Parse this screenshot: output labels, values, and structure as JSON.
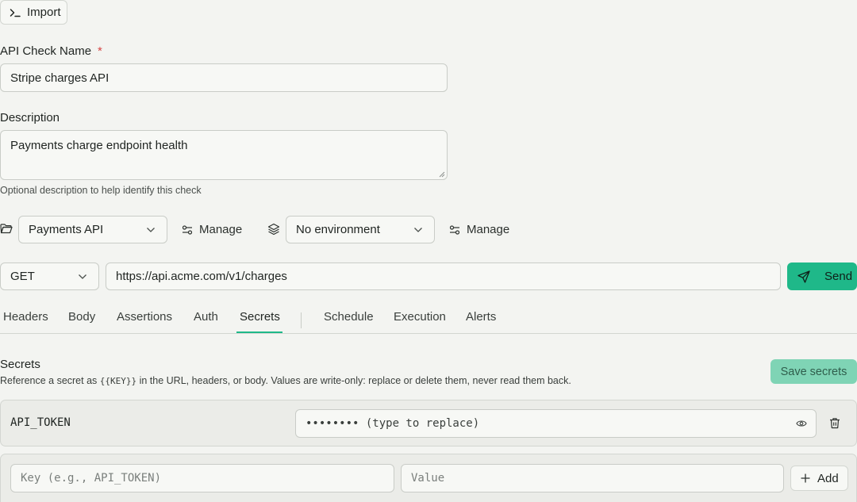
{
  "import_button": {
    "label": "Import",
    "icon": "terminal-icon"
  },
  "name_field": {
    "label": "API Check Name",
    "required_mark": "*",
    "value": "Stripe charges API"
  },
  "description_field": {
    "label": "Description",
    "value": "Payments charge endpoint health",
    "helper": "Optional description to help identify this check"
  },
  "group_row": {
    "group_select": "Payments API",
    "group_manage": "Manage",
    "environment_select": "No environment",
    "environment_manage": "Manage"
  },
  "request_row": {
    "method": "GET",
    "url": "https://api.acme.com/v1/charges",
    "send_label": "Send"
  },
  "tabs": [
    {
      "label": "Headers"
    },
    {
      "label": "Body"
    },
    {
      "label": "Assertions"
    },
    {
      "label": "Auth"
    },
    {
      "label": "Secrets"
    },
    {
      "label": "Schedule"
    },
    {
      "label": "Execution"
    },
    {
      "label": "Alerts"
    }
  ],
  "active_tab": "Secrets",
  "secrets": {
    "title": "Secrets",
    "desc_before": "Reference a secret as ",
    "desc_code": "{{KEY}}",
    "desc_after": " in the URL, headers, or body. Values are write-only: replace or delete them, never read them back.",
    "save_label": "Save secrets",
    "items": [
      {
        "key": "API_TOKEN",
        "value_placeholder": "•••••••• (type to replace)"
      }
    ],
    "new_key_placeholder": "Key (e.g., API_TOKEN)",
    "new_value_placeholder": "Value",
    "add_label": "Add"
  },
  "colors": {
    "accent": "#1fb889",
    "accent_muted": "#7fd4b5",
    "background": "#f3f4f1",
    "required": "#d64545"
  }
}
